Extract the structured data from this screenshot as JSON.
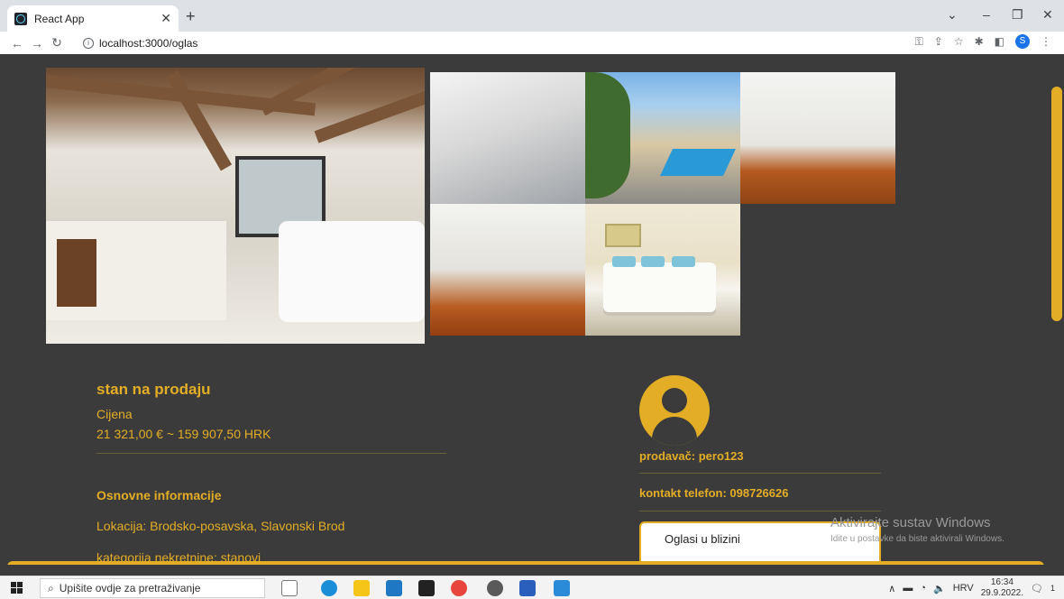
{
  "browser": {
    "tab_title": "React App",
    "url": "localhost:3000/oglas",
    "new_tab": "+",
    "close": "✕",
    "profile_initial": "S"
  },
  "listing": {
    "title": "stan na prodaju",
    "price_label": "Cijena",
    "price": "21 321,00 € ~ 159 907,50 HRK",
    "section_heading": "Osnovne informacije",
    "location": "Lokacija: Brodsko-posavska, Slavonski Brod",
    "category": "kategorija nekretnine: stanovi"
  },
  "seller": {
    "name_line": "prodavač: pero123",
    "phone_line": "kontakt telefon: 098726626",
    "nearby_button": "Oglasi u blizini"
  },
  "watermark": {
    "line1": "Aktivirajte sustav Windows",
    "line2": "Idite u postavke da biste aktivirali Windows."
  },
  "taskbar": {
    "search_placeholder": "Upišite ovdje za pretraživanje",
    "language": "HRV",
    "time": "16:34",
    "date": "29.9.2022.",
    "notification_count": "1"
  },
  "colors": {
    "accent": "#e4ad26",
    "page_bg": "#3b3b3b"
  }
}
